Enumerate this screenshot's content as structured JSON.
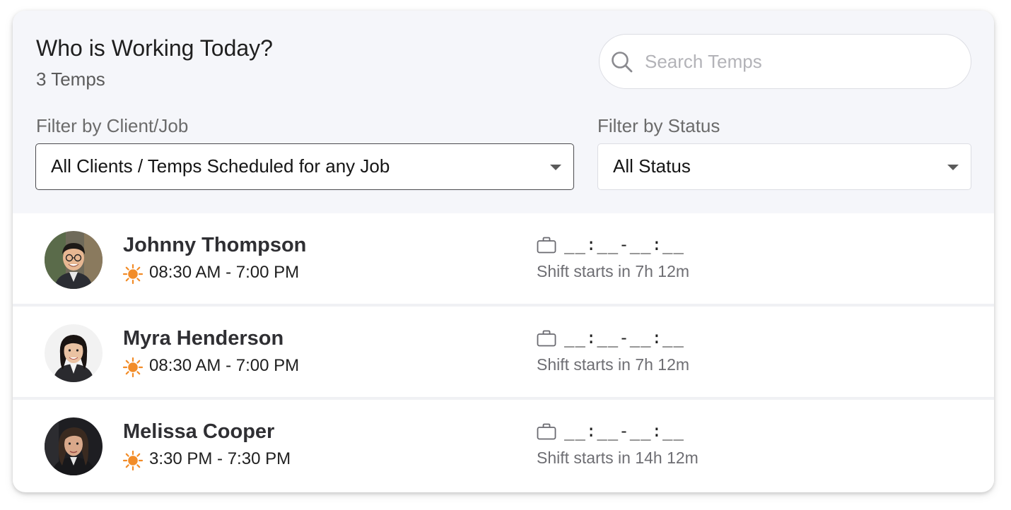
{
  "header": {
    "title": "Who is Working Today?",
    "subtitle": "3 Temps"
  },
  "search": {
    "placeholder": "Search Temps",
    "icon": "search-icon"
  },
  "filters": {
    "client_label": "Filter by Client/Job",
    "client_value": "All Clients / Temps Scheduled for any Job",
    "status_label": "Filter by Status",
    "status_value": "All Status"
  },
  "temps": [
    {
      "name": "Johnny Thompson",
      "time": "08:30 AM - 7:00 PM",
      "shift_placeholder": "__:__-__:__",
      "shift_starts": "Shift starts in 7h 12m"
    },
    {
      "name": "Myra Henderson",
      "time": "08:30 AM - 7:00 PM",
      "shift_placeholder": "__:__-__:__",
      "shift_starts": "Shift starts in 7h 12m"
    },
    {
      "name": "Melissa Cooper",
      "time": "3:30 PM - 7:30 PM",
      "shift_placeholder": "__:__-__:__",
      "shift_starts": "Shift starts in 14h 12m"
    }
  ],
  "colors": {
    "header_bg": "#f5f6fa",
    "sun": "#f28c28",
    "text_primary": "#1f1f1f",
    "text_secondary": "#6b6b6b"
  }
}
